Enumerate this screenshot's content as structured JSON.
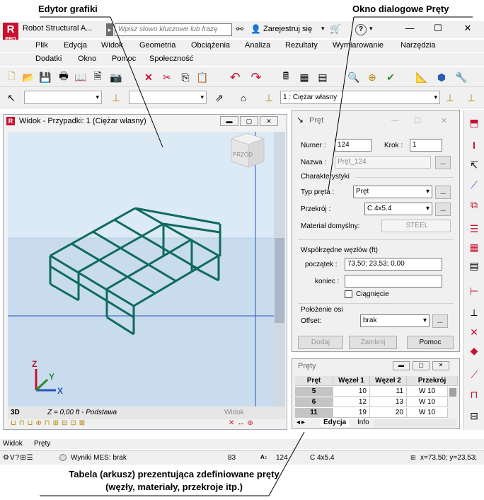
{
  "callouts": {
    "editor": "Edytor grafiki",
    "dialog": "Okno dialogowe Pręty",
    "table_line1": "Tabela (arkusz) prezentująca zdefiniowane pręty",
    "table_line2": "(węzły, materiały, przekroje itp.)"
  },
  "titlebar": {
    "logo_text": "R",
    "logo_sub": "PRO",
    "app_title": "Robot Structural A...",
    "search_placeholder": "Wpisz słowo kluczowe lub frazę",
    "signin": "Zarejestruj się",
    "help": "?"
  },
  "menu": {
    "row1": [
      "Plik",
      "Edycja",
      "Widok",
      "Geometria",
      "Obciążenia",
      "Analiza",
      "Rezultaty",
      "Wymiarowanie",
      "Narzędzia"
    ],
    "row2": [
      "Dodatki",
      "Okno",
      "Pomoc",
      "Społeczność"
    ]
  },
  "toolbar2": {
    "case_combo": "1 : Ciężar własny"
  },
  "view": {
    "title": "Widok - Przypadki: 1 (Ciężar własny)",
    "cube_label": "PRZÓD",
    "mode": "3D",
    "z_label": "Z = 0,00 ft - Podstawa",
    "tab_label": "Widok",
    "axes": {
      "z": "Z",
      "y": "Y",
      "x": "X"
    }
  },
  "dialog": {
    "title": "Pręt",
    "numer_label": "Numer :",
    "numer_value": "124",
    "krok_label": "Krok :",
    "krok_value": "1",
    "nazwa_label": "Nazwa :",
    "nazwa_value": "Pręt_124",
    "section_char": "Charakterystyki",
    "typ_label": "Typ pręta :",
    "typ_value": "Pręt",
    "przekroj_label": "Przekrój :",
    "przekroj_value": "C 4x5.4",
    "material_label": "Materiał domyślny:",
    "material_value": "STEEL",
    "section_coords": "Współrzędne węzłów (ft)",
    "poczatek_label": "początek :",
    "poczatek_value": "73,50; 23,53; 0,00",
    "koniec_label": "koniec :",
    "koniec_value": "",
    "ciagniecie": "Ciągnięcie",
    "section_axis": "Położenie osi",
    "offset_label": "Offset:",
    "offset_value": "brak",
    "btn_add": "Dodaj",
    "btn_close": "Zamknij",
    "btn_help": "Pomoc",
    "ellipsis": "..."
  },
  "table": {
    "title": "Pręty",
    "headers": [
      "Pręt",
      "Węzeł 1",
      "Węzeł 2",
      "Przekrój"
    ],
    "rows": [
      [
        "5",
        "10",
        "11",
        "W 10"
      ],
      [
        "6",
        "12",
        "13",
        "W 10"
      ],
      [
        "11",
        "19",
        "20",
        "W 10"
      ]
    ],
    "tabs": [
      "Edycja",
      "Info"
    ]
  },
  "bottom_tabs": [
    "Widok",
    "Pręty"
  ],
  "statusbar": {
    "results": "Wyniki MES: brak",
    "value1": "83",
    "value2": "124",
    "section": "C 4x5.4",
    "coords": "x=73,50; y=23,53;"
  },
  "colors": {
    "brand": "#c8102e",
    "structure": "#0f6b5c",
    "canvas_sky": "#d8e8f4",
    "canvas_floor": "#c4d8ec"
  }
}
